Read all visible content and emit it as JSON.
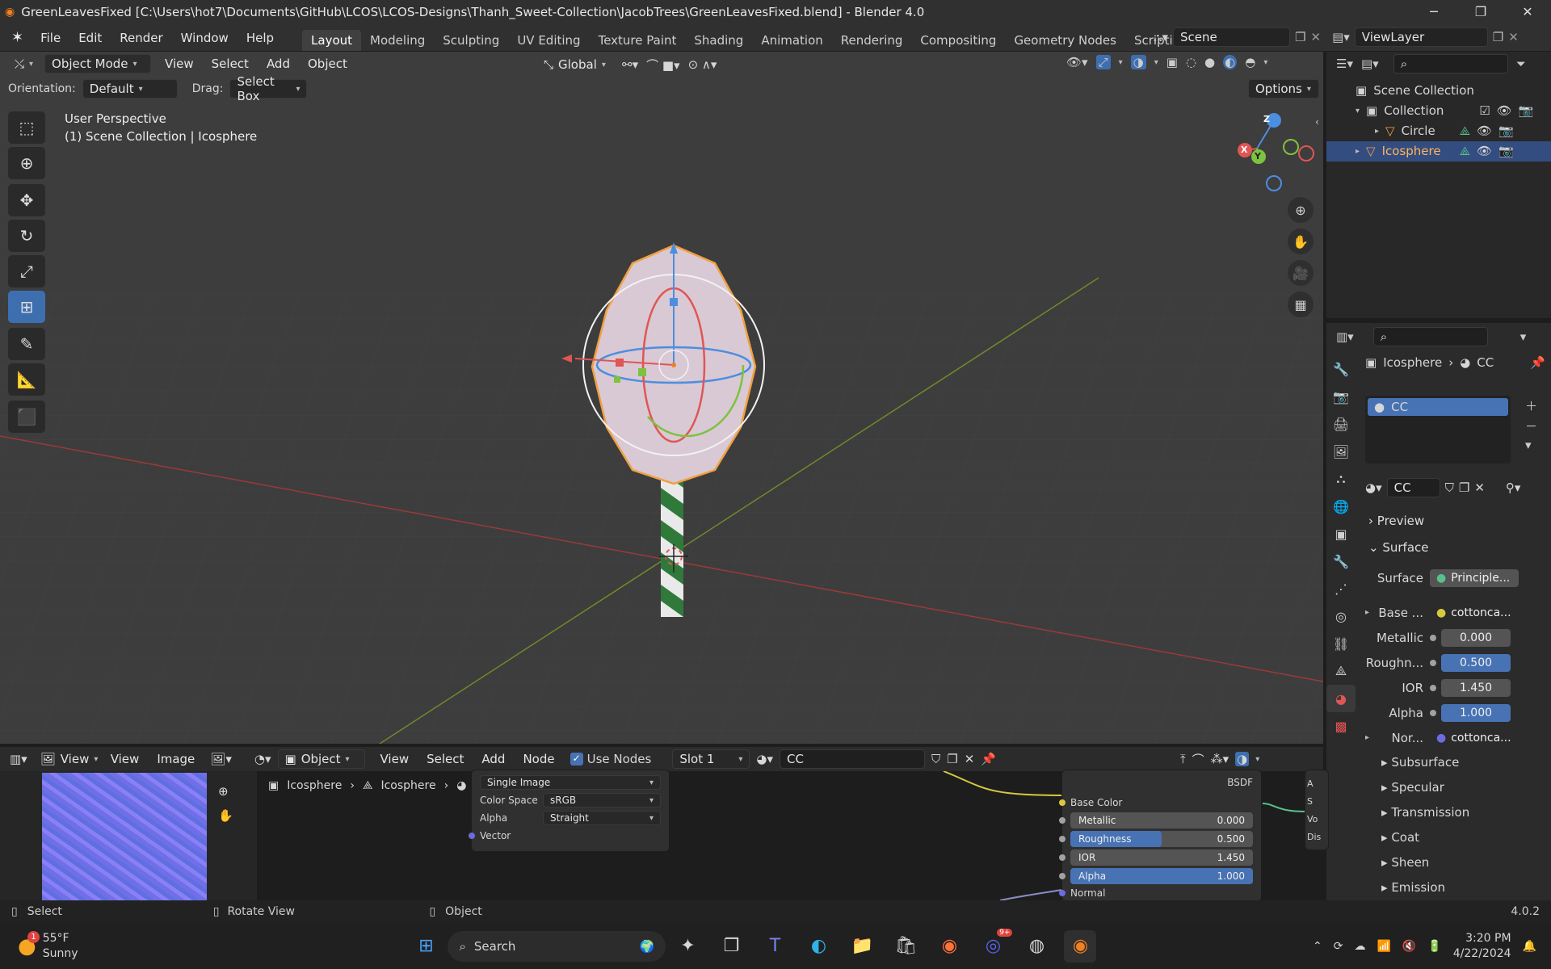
{
  "window": {
    "title": "GreenLeavesFixed [C:\\Users\\hot7\\Documents\\GitHub\\LCOS\\LCOS-Designs\\Thanh_Sweet-Collection\\JacobTrees\\GreenLeavesFixed.blend] - Blender 4.0",
    "controls": [
      "─",
      "❐",
      "✕"
    ]
  },
  "menu": [
    "File",
    "Edit",
    "Render",
    "Window",
    "Help"
  ],
  "workspaces": [
    "Layout",
    "Modeling",
    "Sculpting",
    "UV Editing",
    "Texture Paint",
    "Shading",
    "Animation",
    "Rendering",
    "Compositing",
    "Geometry Nodes",
    "Scripting"
  ],
  "scene": {
    "label": "Scene",
    "viewlayer": "ViewLayer"
  },
  "viewport": {
    "mode": "Object Mode",
    "menus": [
      "View",
      "Select",
      "Add",
      "Object"
    ],
    "transform_orientation": "Global",
    "orientation_label": "Orientation:",
    "orientation_value": "Default",
    "drag_label": "Drag:",
    "drag_value": "Select Box",
    "options": "Options",
    "overlay_line1": "User Perspective",
    "overlay_line2": "(1) Scene Collection | Icosphere",
    "gizmo_axes": [
      "X",
      "Y",
      "Z"
    ]
  },
  "outliner": {
    "root": "Scene Collection",
    "collection": "Collection",
    "items": [
      "Circle",
      "Icosphere"
    ]
  },
  "properties": {
    "breadcrumb_obj": "Icosphere",
    "breadcrumb_mat": "CC",
    "slot_name": "CC",
    "material_name": "CC",
    "sections": {
      "preview": "Preview",
      "surface": "Surface"
    },
    "surface_label": "Surface",
    "surface_value": "Principle...",
    "base_label": "Base ...",
    "base_value": "cottonca...",
    "metallic_label": "Metallic",
    "metallic": "0.000",
    "roughness_label": "Roughn...",
    "roughness": "0.500",
    "ior_label": "IOR",
    "ior": "1.450",
    "alpha_label": "Alpha",
    "alpha": "1.000",
    "normal_label": "Nor...",
    "normal_value": "cottonca...",
    "subsections": [
      "Subsurface",
      "Specular",
      "Transmission",
      "Coat",
      "Sheen",
      "Emission"
    ]
  },
  "image_editor": {
    "view": "View",
    "menus": [
      "View",
      "Image"
    ]
  },
  "node_editor": {
    "object": "Object",
    "menus": [
      "View",
      "Select",
      "Add",
      "Node"
    ],
    "use_nodes": "Use Nodes",
    "slot": "Slot 1",
    "material": "CC",
    "breadcrumb_obj": "Icosphere",
    "breadcrumb_mesh": "Icosphere",
    "breadcrumb_mat": "CC",
    "image_node": {
      "single": "Single Image",
      "colorspace_label": "Color Space",
      "colorspace": "sRGB",
      "alpha_label": "Alpha",
      "alpha": "Straight",
      "vector": "Vector"
    },
    "bsdf": {
      "title": "BSDF",
      "base_color": "Base Color",
      "metallic_label": "Metallic",
      "metallic": "0.000",
      "roughness_label": "Roughness",
      "roughness": "0.500",
      "ior_label": "IOR",
      "ior": "1.450",
      "alpha_label": "Alpha",
      "alpha": "1.000",
      "normal": "Normal"
    },
    "output_partial": [
      "A",
      "S",
      "Vo",
      "Dis"
    ]
  },
  "status": {
    "left": "Select",
    "middle": "Rotate View",
    "right": "Object",
    "version": "4.0.2"
  },
  "taskbar": {
    "temp": "55°F",
    "weather": "Sunny",
    "weather_badge": "1",
    "search": "Search",
    "discord_badge": "9+",
    "time": "3:20 PM",
    "date": "4/22/2024"
  }
}
